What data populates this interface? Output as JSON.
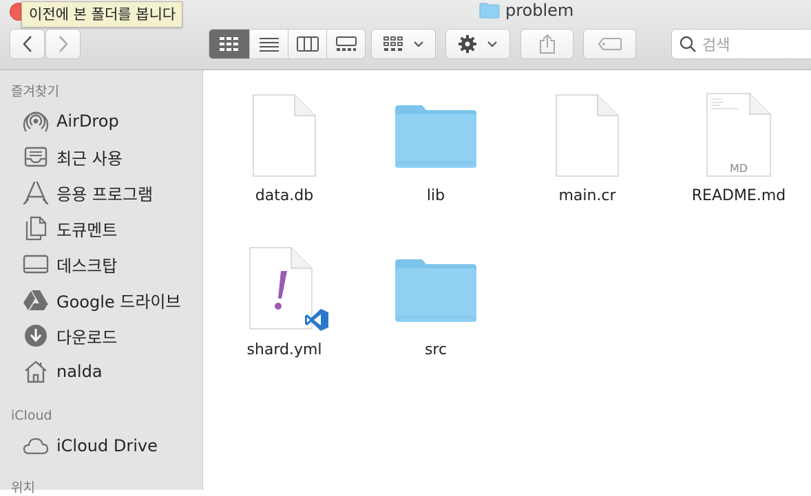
{
  "window": {
    "title": "problem"
  },
  "tooltip": {
    "text": "이전에 본 폴더를 봅니다"
  },
  "search": {
    "placeholder": "검색"
  },
  "sidebar": {
    "favorites_title": "즐겨찾기",
    "favorites": [
      {
        "label": "AirDrop",
        "icon": "airdrop-icon"
      },
      {
        "label": "최근 사용",
        "icon": "recents-icon"
      },
      {
        "label": "응용 프로그램",
        "icon": "applications-icon"
      },
      {
        "label": "도큐멘트",
        "icon": "documents-icon"
      },
      {
        "label": "데스크탑",
        "icon": "desktop-icon"
      },
      {
        "label": "Google 드라이브",
        "icon": "google-drive-icon"
      },
      {
        "label": "다운로드",
        "icon": "downloads-icon"
      },
      {
        "label": "nalda",
        "icon": "home-icon"
      }
    ],
    "icloud_title": "iCloud",
    "icloud": [
      {
        "label": "iCloud Drive",
        "icon": "cloud-icon"
      }
    ],
    "locations_title": "위치"
  },
  "files": [
    {
      "name": "data.db",
      "kind": "document"
    },
    {
      "name": "lib",
      "kind": "folder"
    },
    {
      "name": "main.cr",
      "kind": "document"
    },
    {
      "name": "README.md",
      "kind": "markdown",
      "badge": "MD"
    },
    {
      "name": "shard.yml",
      "kind": "yaml"
    },
    {
      "name": "src",
      "kind": "folder"
    }
  ],
  "colors": {
    "folder": "#8fd0f3",
    "folder_tab": "#7cc4ec",
    "tooltip_bg": "#f4f1cf",
    "yaml_mark": "#9b59b6",
    "vscode": "#2a7ac9"
  }
}
